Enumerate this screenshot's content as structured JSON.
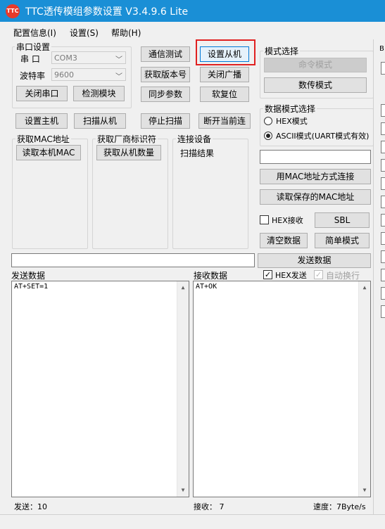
{
  "window": {
    "title": "TTC透传模组参数设置 V3.4.9.6 Lite",
    "logo_text": "TTC"
  },
  "menu": [
    {
      "label": "配置信息(I)"
    },
    {
      "label": "设置(S)"
    },
    {
      "label": "帮助(H)"
    }
  ],
  "serial": {
    "group_label": "串口设置",
    "port_label": "串 口",
    "port_value": "COM3",
    "baud_label": "波特率",
    "baud_value": "9600",
    "close_button": "关闭串口",
    "detect_button": "检测模块"
  },
  "buttons": {
    "comm_test": "通信测试",
    "set_slave": "设置从机",
    "get_version": "获取版本号",
    "close_broadcast": "关闭广播",
    "sync_params": "同步参数",
    "soft_reset": "软复位",
    "set_master": "设置主机",
    "scan_slave": "扫描从机",
    "stop_scan": "停止扫描",
    "disconnect_forward": "断开当前连"
  },
  "mac_group": {
    "label": "获取MAC地址",
    "button": "读取本机MAC"
  },
  "vendor_group": {
    "label": "获取厂商标识符",
    "button": "获取从机数量"
  },
  "connect_group": {
    "label": "连接设备",
    "result": "扫描结果"
  },
  "mode_select": {
    "label": "模式选择",
    "command_mode": "命令模式",
    "passthrough_mode": "数传模式"
  },
  "data_mode": {
    "label": "数据模式选择",
    "hex_mode": "HEX模式",
    "ascii_mode": "ASCII模式(UART模式有效)"
  },
  "mac_connect": {
    "input_value": "",
    "connect_button": "用MAC地址方式连接",
    "read_saved_button": "读取保存的MAC地址"
  },
  "hex_recv": {
    "label": "HEX接收",
    "checked": false
  },
  "sbl_button": "SBL",
  "clear_button": "清空数据",
  "simple_mode_button": "简单模式",
  "send_input_value": "",
  "send_button": "发送数据",
  "send_panel": {
    "label": "发送数据",
    "content": "AT+SET=1"
  },
  "recv_panel": {
    "label": "接收数据",
    "content": "AT+OK"
  },
  "hex_send": {
    "label": "HEX发送",
    "checked": true
  },
  "auto_wrap": {
    "label": "自动换行",
    "checked": true
  },
  "status": {
    "sent": "发送：10",
    "received": "接收：  7",
    "speed": "速度：7Byte/s"
  },
  "right_edge_label": "B",
  "colors": {
    "title_bar": "#1a8fd6",
    "highlight": "#e02020",
    "logo": "#e83a2b"
  }
}
